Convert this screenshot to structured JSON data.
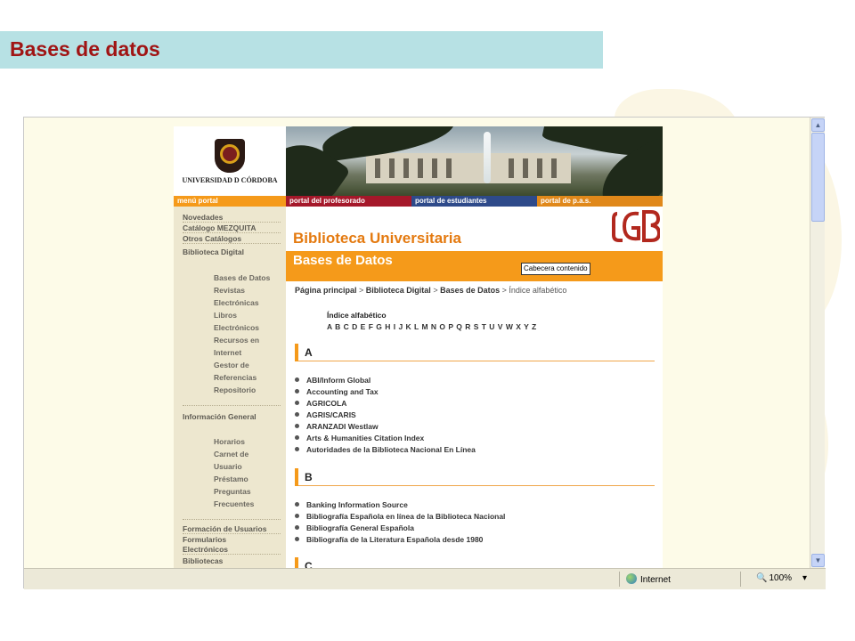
{
  "slide": {
    "title": "Bases de datos"
  },
  "site": {
    "university_name": "UNIVERSIDAD D CÓRDOBA",
    "nav_strip": [
      "menú portal",
      "portal del profesorado",
      "portal de estudiantes",
      "portal de p.a.s."
    ],
    "nav_colors": [
      "#f59a1a",
      "#a5182a",
      "#2e4a8a",
      "#e0881a"
    ],
    "left_nav": {
      "top_items": [
        "Novedades",
        "Catálogo MEZQUITA",
        "Otros Catálogos",
        "Biblioteca Digital"
      ],
      "biblioteca_digital_sub": [
        "Bases de Datos",
        "Revistas",
        "Electrónicas",
        "Libros",
        "Electrónicos",
        "Recursos en",
        "Internet",
        "Gestor de",
        "Referencias",
        "Repositorio"
      ],
      "informacion_general": "Información General",
      "informacion_general_sub": [
        "Horarios",
        "Carnet de",
        "Usuario",
        "Préstamo",
        "Preguntas",
        "Frecuentes"
      ],
      "bottom_items": [
        "Formación de Usuarios",
        "Formularios",
        "Electrónicos",
        "Bibliotecas"
      ]
    },
    "content": {
      "library_title": "Biblioteca Universitaria",
      "section_title": "Bases de Datos",
      "header_button": "Cabecera contenido",
      "breadcrumb": {
        "home": "Página principal",
        "sep": " > ",
        "digital": "Biblioteca Digital",
        "databases": "Bases de Datos",
        "current": "Índice alfabético"
      },
      "index_title": "Índice alfabético",
      "letters": "A B C D E F G H I J K L M N O P Q R S T U V W X Y Z",
      "sections": [
        {
          "letter": "A",
          "items": [
            "ABI/Inform Global",
            "Accounting and Tax",
            "AGRICOLA",
            "AGRIS/CARIS",
            "ARANZADI Westlaw",
            "Arts & Humanities Citation Index",
            "Autoridades de la Biblioteca Nacional En Línea"
          ]
        },
        {
          "letter": "B",
          "items": [
            "Banking Information Source",
            "Bibliografía Española en línea de la Biblioteca Nacional",
            "Bibliografía General Española",
            "Bibliografía de la Literatura Española desde 1980"
          ]
        },
        {
          "letter": "C"
        }
      ]
    }
  },
  "statusbar": {
    "zone": "Internet",
    "zoom": "100%",
    "zoom_arrow": "▾"
  },
  "colors": {
    "title_bar": "#b7e1e4",
    "title_text": "#a01414",
    "accent_orange": "#f59a1a"
  }
}
